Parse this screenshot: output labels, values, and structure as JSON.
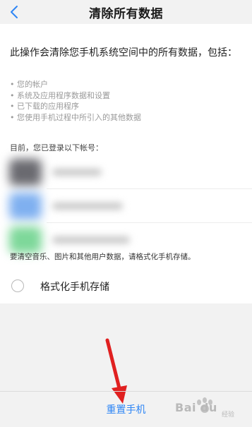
{
  "header": {
    "title": "清除所有数据",
    "back_icon": "chevron-left-icon"
  },
  "main": {
    "intro": "此操作会清除您手机系统空间中的所有数据，包括：",
    "items": [
      "您的帐户",
      "系统及应用程序数据和设置",
      "已下载的应用程序",
      "您使用手机过程中所引入的其他数据"
    ],
    "login_label": "目前，您已登录以下帐号：",
    "accounts_note": "Account avatars and names are blurred in the screenshot",
    "note": "要清空音乐、图片和其他用户数据，请格式化手机存储。",
    "format_option": {
      "label": "格式化手机存储",
      "checked": false
    }
  },
  "footer": {
    "reset_label": "重置手机"
  },
  "watermark": {
    "logo_text": "Bai du",
    "logo_suffix": "经验"
  },
  "colors": {
    "accent": "#2f86f5",
    "arrow": "#e02020",
    "background": "#f2f2f2"
  }
}
